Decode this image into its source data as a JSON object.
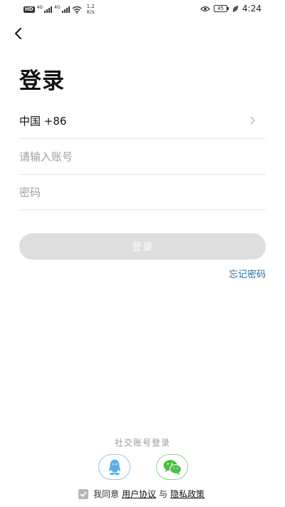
{
  "status_bar": {
    "hd_label": "HD",
    "net_tag_1": "4G",
    "net_tag_2": "4G",
    "speed_value": "1.2",
    "speed_unit": "K/s",
    "battery_level": "45",
    "time": "4:24",
    "icons": [
      "hd-icon",
      "signal-icon",
      "signal-icon",
      "wifi-icon",
      "eye-icon",
      "battery-icon",
      "leaf-icon"
    ]
  },
  "nav": {
    "back_icon": "chevron-left-icon"
  },
  "page": {
    "title": "登录"
  },
  "form": {
    "country_label": "中国 +86",
    "account_placeholder": "请输入账号",
    "password_placeholder": "密码",
    "login_button": "登录",
    "forgot_password": "忘记密码"
  },
  "social": {
    "title": "社交账号登录",
    "providers": [
      {
        "icon": "qq-icon",
        "color": "#5aaee8"
      },
      {
        "icon": "wechat-icon",
        "color": "#4cbf44"
      }
    ]
  },
  "agreement": {
    "checked": true,
    "prefix": "我同意",
    "user_agreement": "用户协议",
    "connector": "与",
    "privacy_policy": "隐私政策"
  },
  "colors": {
    "accent_link": "#2b6fa3",
    "button_disabled": "#dedede",
    "divider": "#e5e5e5"
  }
}
